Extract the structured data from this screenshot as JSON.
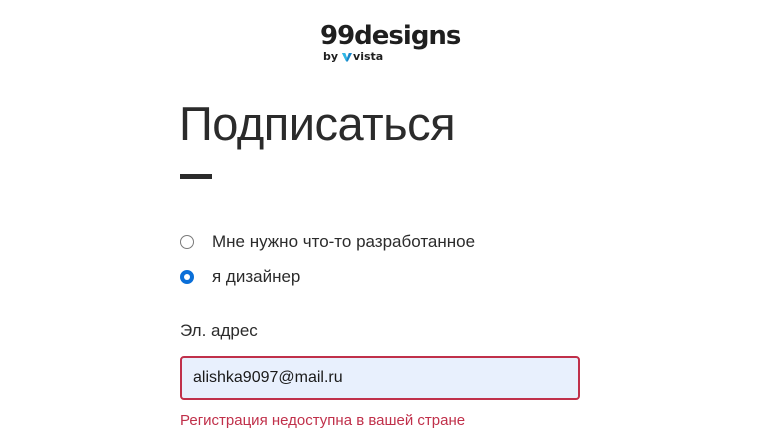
{
  "logo": {
    "wordmark": "99designs",
    "by": "by",
    "partner": "vista",
    "partner_icon": "vista-check-icon",
    "color": "#1f1f1f"
  },
  "form": {
    "title": "Подписаться",
    "account_type": {
      "options": [
        {
          "label": "Мне нужно что-то разработанное",
          "checked": false
        },
        {
          "label": "я дизайнер",
          "checked": true
        }
      ]
    },
    "email": {
      "label": "Эл. адрес",
      "value": "alishka9097@mail.ru"
    },
    "error": "Регистрация недоступна в вашей стране"
  },
  "colors": {
    "accent": "#0b6fd8",
    "error": "#c0304a",
    "input_bg": "#e8f0fd",
    "text": "#2b2b2b"
  }
}
